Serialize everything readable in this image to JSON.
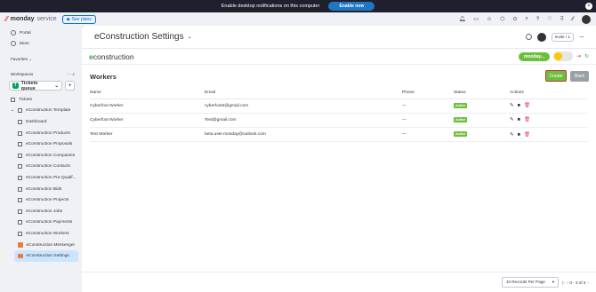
{
  "notification": {
    "text": "Enable desktop notifications on this computer",
    "button": "Enable now"
  },
  "topbar": {
    "brand_bold": "monday",
    "brand_rest": " service",
    "see_plans": "See plans"
  },
  "sidebar": {
    "top_items": [
      {
        "label": "Portal"
      },
      {
        "label": "More"
      }
    ],
    "favorites": "Favorites",
    "workspaces": "Workspaces",
    "workspace_name": "Tickets queue",
    "workspace_initial": "T",
    "tickets": "Tickets",
    "template": "eConstruction Template",
    "tree": [
      "Dashboard",
      "eConstruction Products",
      "eConstruction Proposals",
      "eConstruction Companies",
      "eConstruction Contacts",
      "eConstruction Pre-Qualif...",
      "eConstruction Bids",
      "eConstruction Projects",
      "eConstruction Jobs",
      "eConstruction Payments",
      "eConstruction Workers",
      "eConstruction Messenger",
      "eConstruction Settings"
    ]
  },
  "header": {
    "title": "eConstruction Settings",
    "invite": "Invite / 1"
  },
  "app": {
    "brand_e": "e",
    "brand_rest": "construction",
    "monday_badge": "monday...",
    "section_title": "Workers",
    "create": "Create",
    "back": "Back"
  },
  "table": {
    "headers": [
      "Name",
      "Email",
      "Phone",
      "Status",
      "Actions"
    ],
    "rows": [
      {
        "name": "Cyberfoot Worker",
        "email": "cyberfoot2@gmail.com",
        "phone": "—",
        "status": "Active"
      },
      {
        "name": "Cyberfoot Worker",
        "email": "Test@gmail.com",
        "phone": "—",
        "status": "Active"
      },
      {
        "name": "Test Worker",
        "email": "beta.user.monday@outlook.com",
        "phone": "—",
        "status": "Active"
      }
    ]
  },
  "footer": {
    "records_per_page": "10 Records Per Page",
    "range": "0 - 3 of 3"
  }
}
